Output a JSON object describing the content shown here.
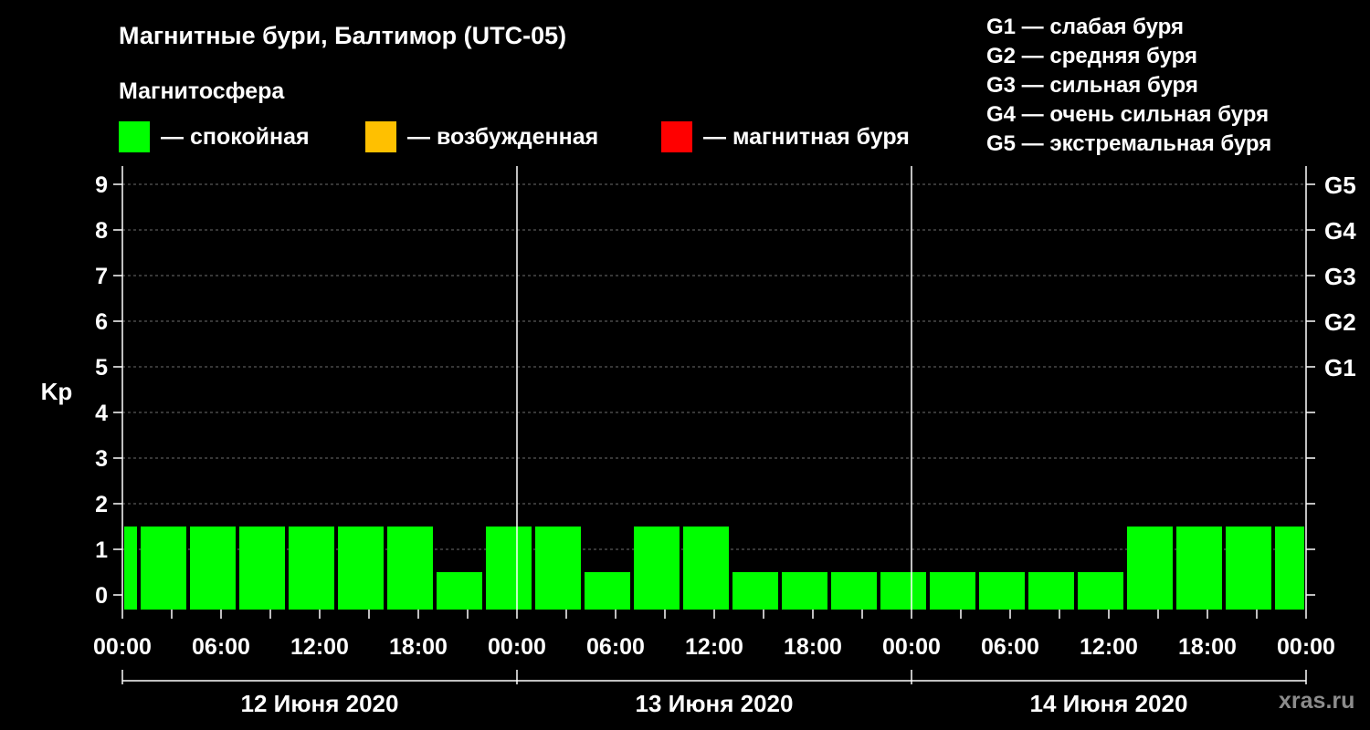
{
  "header": {
    "title": "Магнитные бури, Балтимор (UTC-05)",
    "subtitle": "Магнитосфера"
  },
  "legend": {
    "items": [
      {
        "label": "— спокойная",
        "color": "#00ff00"
      },
      {
        "label": "— возбужденная",
        "color": "#ffc000"
      },
      {
        "label": "— магнитная буря",
        "color": "#ff0000"
      }
    ]
  },
  "storm_legend": [
    "G1 — слабая буря",
    "G2 — средняя буря",
    "G3 — сильная буря",
    "G4 — очень сильная буря",
    "G5 — экстремальная буря"
  ],
  "watermark": "xras.ru",
  "chart_data": {
    "type": "bar",
    "title": "Магнитные бури, Балтимор (UTC-05)",
    "ylabel": "Kp",
    "ylim": [
      0,
      9
    ],
    "yticks": [
      "0",
      "1",
      "2",
      "3",
      "4",
      "5",
      "6",
      "7",
      "8",
      "9"
    ],
    "right_ticks": [
      {
        "value": 5,
        "label": "G1"
      },
      {
        "value": 6,
        "label": "G2"
      },
      {
        "value": 7,
        "label": "G3"
      },
      {
        "value": 8,
        "label": "G4"
      },
      {
        "value": 9,
        "label": "G5"
      }
    ],
    "xticks": [
      "00:00",
      "06:00",
      "12:00",
      "18:00",
      "00:00",
      "06:00",
      "12:00",
      "18:00",
      "00:00",
      "06:00",
      "12:00",
      "18:00",
      "00:00"
    ],
    "day_labels": [
      "12 Июня 2020",
      "13 Июня 2020",
      "14 Июня 2020"
    ],
    "grid": true,
    "bar_color": "#00ff00",
    "bars": [
      {
        "start": "12 Июня 2020 00:00",
        "end": "12 Июня 2020 01:00",
        "kp": 1
      },
      {
        "start": "12 Июня 2020 01:00",
        "end": "12 Июня 2020 04:00",
        "kp": 1
      },
      {
        "start": "12 Июня 2020 04:00",
        "end": "12 Июня 2020 07:00",
        "kp": 1
      },
      {
        "start": "12 Июня 2020 07:00",
        "end": "12 Июня 2020 10:00",
        "kp": 1
      },
      {
        "start": "12 Июня 2020 10:00",
        "end": "12 Июня 2020 13:00",
        "kp": 1
      },
      {
        "start": "12 Июня 2020 13:00",
        "end": "12 Июня 2020 16:00",
        "kp": 1
      },
      {
        "start": "12 Июня 2020 16:00",
        "end": "12 Июня 2020 19:00",
        "kp": 1
      },
      {
        "start": "12 Июня 2020 19:00",
        "end": "12 Июня 2020 22:00",
        "kp": 0
      },
      {
        "start": "12 Июня 2020 22:00",
        "end": "13 Июня 2020 01:00",
        "kp": 1
      },
      {
        "start": "13 Июня 2020 01:00",
        "end": "13 Июня 2020 04:00",
        "kp": 1
      },
      {
        "start": "13 Июня 2020 04:00",
        "end": "13 Июня 2020 07:00",
        "kp": 0
      },
      {
        "start": "13 Июня 2020 07:00",
        "end": "13 Июня 2020 10:00",
        "kp": 1
      },
      {
        "start": "13 Июня 2020 10:00",
        "end": "13 Июня 2020 13:00",
        "kp": 1
      },
      {
        "start": "13 Июня 2020 13:00",
        "end": "13 Июня 2020 16:00",
        "kp": 0
      },
      {
        "start": "13 Июня 2020 16:00",
        "end": "13 Июня 2020 19:00",
        "kp": 0
      },
      {
        "start": "13 Июня 2020 19:00",
        "end": "13 Июня 2020 22:00",
        "kp": 0
      },
      {
        "start": "13 Июня 2020 22:00",
        "end": "14 Июня 2020 01:00",
        "kp": 0
      },
      {
        "start": "14 Июня 2020 01:00",
        "end": "14 Июня 2020 04:00",
        "kp": 0
      },
      {
        "start": "14 Июня 2020 04:00",
        "end": "14 Июня 2020 07:00",
        "kp": 0
      },
      {
        "start": "14 Июня 2020 07:00",
        "end": "14 Июня 2020 10:00",
        "kp": 0
      },
      {
        "start": "14 Июня 2020 10:00",
        "end": "14 Июня 2020 13:00",
        "kp": 0
      },
      {
        "start": "14 Июня 2020 13:00",
        "end": "14 Июня 2020 16:00",
        "kp": 1
      },
      {
        "start": "14 Июня 2020 16:00",
        "end": "14 Июня 2020 19:00",
        "kp": 1
      },
      {
        "start": "14 Июня 2020 19:00",
        "end": "14 Июня 2020 22:00",
        "kp": 1
      },
      {
        "start": "14 Июня 2020 22:00",
        "end": "15 Июня 2020 00:00",
        "kp": 1
      }
    ]
  }
}
